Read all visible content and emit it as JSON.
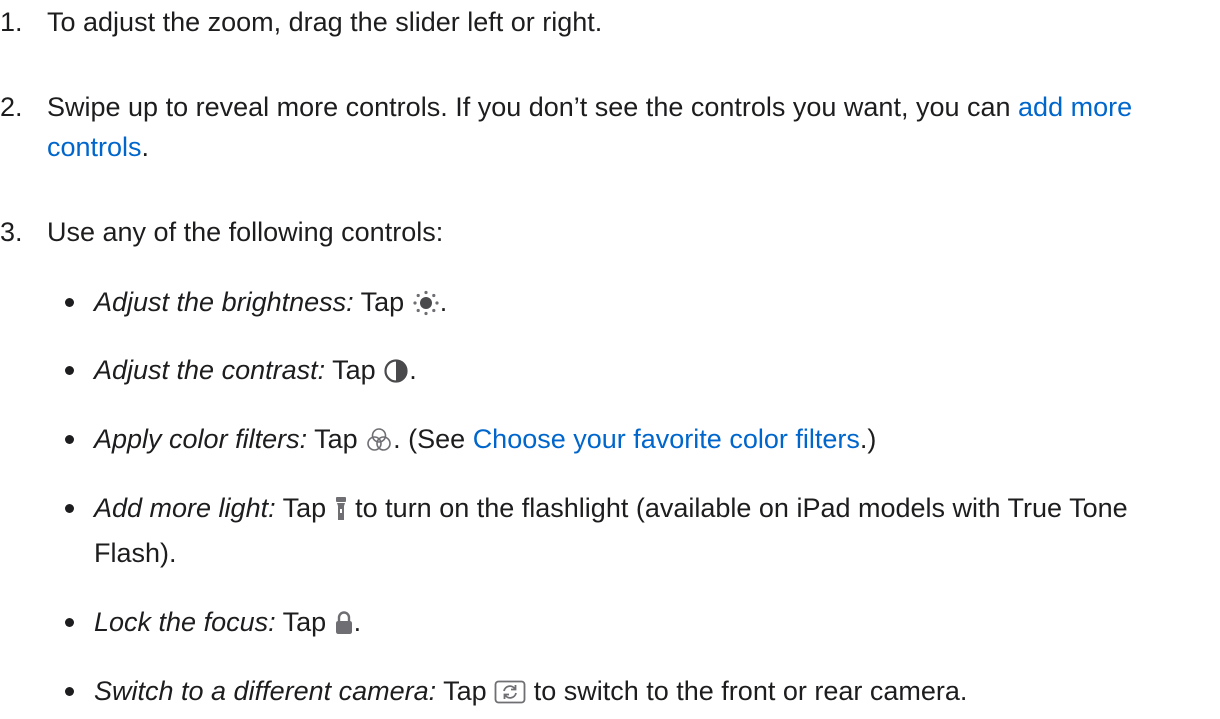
{
  "steps": [
    {
      "number": "1.",
      "text": "To adjust the zoom, drag the slider left or right."
    },
    {
      "number": "2.",
      "text_before": "Swipe up to reveal more controls. If you don’t see the controls you want, you can ",
      "link": "add more controls",
      "text_after": "."
    },
    {
      "number": "3.",
      "text": "Use any of the following controls:"
    }
  ],
  "bullets": [
    {
      "term": "Adjust the brightness:",
      "tap": " Tap ",
      "icon": "brightness-icon",
      "after": "."
    },
    {
      "term": "Adjust the contrast:",
      "tap": " Tap ",
      "icon": "contrast-icon",
      "after": "."
    },
    {
      "term": "Apply color filters:",
      "tap": " Tap ",
      "icon": "color-filters-icon",
      "after": ". (See ",
      "link": "Choose your favorite color filters",
      "after_link": ".)"
    },
    {
      "term": "Add more light:",
      "tap": " Tap ",
      "icon": "flashlight-icon",
      "after": " to turn on the flashlight (available on iPad models with True Tone Flash)."
    },
    {
      "term": "Lock the focus:",
      "tap": " Tap ",
      "icon": "lock-icon",
      "after": "."
    },
    {
      "term": "Switch to a different camera:",
      "tap": " Tap ",
      "icon": "camera-switch-icon",
      "after": " to switch to the front or rear camera."
    }
  ],
  "colors": {
    "text": "#1d1d1f",
    "link": "#0066cc"
  }
}
